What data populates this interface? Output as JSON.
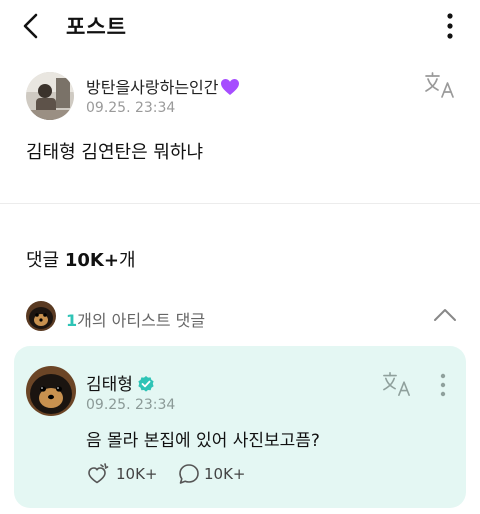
{
  "header": {
    "title": "포스트"
  },
  "post": {
    "author": "방탄을사랑하는인간",
    "timestamp": "09.25. 23:34",
    "body": "김태형 김연탄은 뭐하냐"
  },
  "comments": {
    "label": "댓글",
    "count": "10K+",
    "suffix": "개"
  },
  "artist_comments_row": {
    "count": "1",
    "label": "개의 아티스트 댓글"
  },
  "artist_comment": {
    "author": "김태형",
    "timestamp": "09.25. 23:34",
    "body": "음 몰라 본집에 있어 사진보고픔?",
    "likes": "10K+",
    "replies": "10K+"
  },
  "colors": {
    "accent": "#2ec4b6",
    "card_bg": "#e4f7f3",
    "heart": "#a64dff"
  },
  "icons": [
    "back-arrow-icon",
    "more-vertical-icon",
    "translate-icon",
    "purple-heart-icon",
    "verified-icon",
    "chevron-up-icon",
    "like-icon",
    "reply-icon"
  ]
}
